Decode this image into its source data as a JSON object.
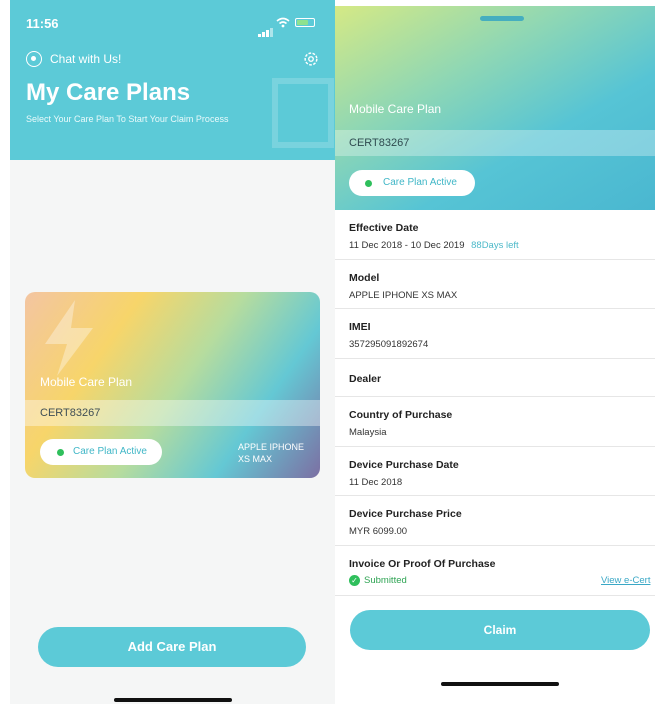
{
  "left": {
    "status_time": "11:56",
    "chat_label": "Chat with Us!",
    "title": "My Care Plans",
    "subtitle": "Select Your Care Plan To Start Your Claim Process",
    "card": {
      "plan_name": "Mobile Care Plan",
      "cert": "CERT83267",
      "status": "Care Plan Active",
      "model_line1": "APPLE IPHONE",
      "model_line2": "XS MAX"
    },
    "add_button": "Add Care Plan"
  },
  "right": {
    "plan_name": "Mobile Care Plan",
    "cert": "CERT83267",
    "status": "Care Plan Active",
    "fields": {
      "effective_label": "Effective Date",
      "effective_value": "11 Dec 2018 - 10 Dec 2019",
      "days_left": "88Days left",
      "model_label": "Model",
      "model_value": "APPLE IPHONE XS MAX",
      "imei_label": "IMEI",
      "imei_value": "357295091892674",
      "dealer_label": "Dealer",
      "country_label": "Country of Purchase",
      "country_value": "Malaysia",
      "purchase_date_label": "Device Purchase Date",
      "purchase_date_value": "11 Dec 2018",
      "price_label": "Device Purchase Price",
      "price_value": "MYR 6099.00",
      "invoice_label": "Invoice Or Proof Of Purchase",
      "invoice_status": "Submitted",
      "view_cert": "View e-Cert"
    },
    "claim_button": "Claim"
  },
  "colors": {
    "teal": "#5ccad7",
    "active_green": "#2fbf5c",
    "link_blue": "#3aa8c6"
  }
}
